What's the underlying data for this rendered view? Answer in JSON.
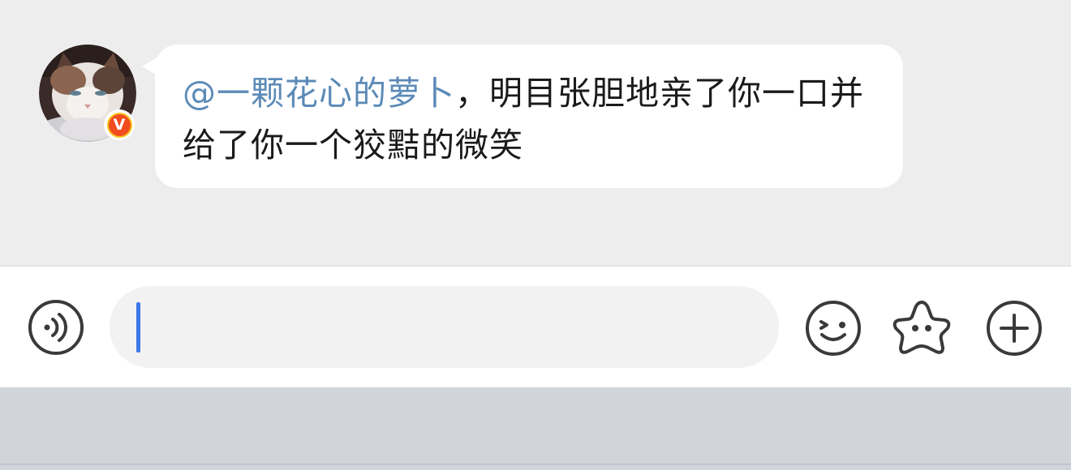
{
  "message": {
    "mention": "@一颗花心的萝卜",
    "text": "，明目张胆地亲了你一口并给了你一个狡黠的微笑",
    "sender_verified_badge": "V"
  },
  "input": {
    "value": "",
    "placeholder": ""
  },
  "toolbar": {
    "voice_icon": "voice-wave-icon",
    "emoji_icon": "wink-face-icon",
    "sticker_icon": "star-face-icon",
    "more_icon": "plus-circle-icon"
  },
  "colors": {
    "chat_background": "#ededed",
    "bubble": "#ffffff",
    "mention": "#5b8ab7",
    "caret": "#3c78e6",
    "badge": "#f04c1f",
    "keyboard_area": "#d1d4db"
  }
}
